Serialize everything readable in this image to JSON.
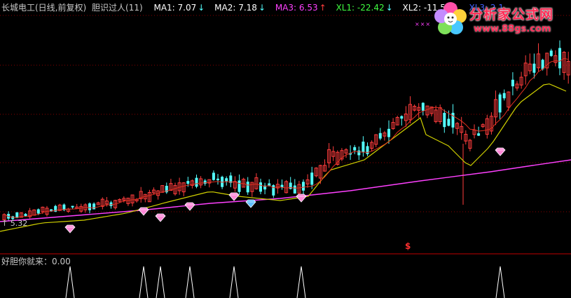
{
  "header": {
    "title": "长城电工(日线,前复权)",
    "indicator": "胆识过人(11)",
    "ma1": "MA1: 7.07",
    "ma2": "MA2: 7.18",
    "ma3": "MA3: 6.53",
    "xl1": "XL1: -22.42",
    "xl2": "XL2: -11.52",
    "xl3": "XL3: 2.1",
    "arrow_down": "↓",
    "arrow_up": "↑"
  },
  "sub_panel": {
    "label": "好胆你就来：0.00"
  },
  "price_label": "↑ 5.32",
  "dollar_mark": "$",
  "marker_text": "×××",
  "watermark": {
    "title": "分析家公式网",
    "url": "www.88gs.com"
  },
  "colors": {
    "up": "#ff3c3c",
    "down": "#54ffff",
    "ma1": "#ffffff",
    "ma2": "#d0d000",
    "ma3": "#ff40ff",
    "xl1": "#40ff40",
    "xl2": "#ffffff",
    "xl3": "#4060ff",
    "grid": "#7a0000",
    "label": "#c8c8c8"
  },
  "chart_data": {
    "type": "candlestick",
    "series": [
      {
        "name": "MA1",
        "value": 7.07
      },
      {
        "name": "MA2",
        "value": 7.18
      },
      {
        "name": "MA3",
        "value": 6.53
      },
      {
        "name": "XL1",
        "value": -22.42
      },
      {
        "name": "XL2",
        "value": -11.52
      },
      {
        "name": "XL3",
        "value": 2.1
      }
    ],
    "low_label": 5.32,
    "signal_panel": {
      "name": "好胆你就来",
      "value": 0.0
    }
  }
}
